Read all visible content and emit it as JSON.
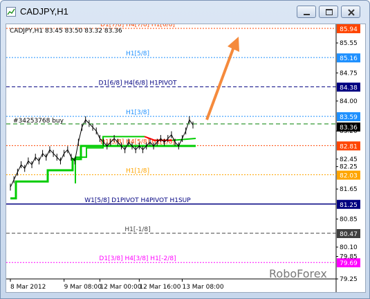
{
  "window": {
    "title": "CADJPY,H1",
    "buttons": [
      "minimize",
      "maximize",
      "close"
    ]
  },
  "chart_info": {
    "ohlc_line": "CADJPY,H1  83.45 83.50 83.32 83.36",
    "order_label": "#34253768 buy",
    "watermark": "RoboForex"
  },
  "colors": {
    "green": "#00cc00",
    "red": "#ff0000",
    "orange_arrow": "#f58a3c",
    "navy": "#000080"
  },
  "chart_data": {
    "type": "line",
    "symbol": "CADJPY",
    "timeframe": "H1",
    "ylim": [
      79.25,
      86.05
    ],
    "y_ticks": [
      "85.55",
      "84.75",
      "84.00",
      "83.20",
      "82.45",
      "82.25",
      "81.65",
      "80.85",
      "80.10",
      "79.85",
      "79.25"
    ],
    "x_ticks": [
      "8 Mar 2012",
      "9 Mar 08:00",
      "12 Mar 00:00",
      "12 Mar 16:00",
      "13 Mar 08:00"
    ],
    "current_price": "83.36",
    "levels": [
      {
        "label": "D1[7/8] H4[7/8] H1[6/8]",
        "value": 85.94,
        "price": "85.94",
        "color": "#ff4500",
        "style": "dot"
      },
      {
        "label": "H1[5/8]",
        "value": 85.16,
        "price": "85.16",
        "color": "#1e90ff",
        "style": "dot"
      },
      {
        "label": "D1[6/8] H4[6/8] H1PIVOT",
        "value": 84.38,
        "price": "84.38",
        "color": "#000080",
        "style": "dash"
      },
      {
        "label": "H1[3/8]",
        "value": 83.59,
        "price": "83.59",
        "color": "#1e90ff",
        "style": "dot"
      },
      {
        "label": "D1[5/8] H4[5/8] H1[2/8]",
        "value": 82.81,
        "price": "82.81",
        "color": "#ff4500",
        "style": "dot"
      },
      {
        "label": "H1[1/8]",
        "value": 82.03,
        "price": "82.03",
        "color": "#ffa500",
        "style": "dot"
      },
      {
        "label": "W1[5/8] D1PIVOT H4PIVOT H1SUP",
        "value": 81.25,
        "price": "81.25",
        "color": "#000080",
        "style": "solid"
      },
      {
        "label": "H1[-1/8]",
        "value": 80.47,
        "price": "80.47",
        "color": "#404040",
        "style": "dash"
      },
      {
        "label": "D1[3/8] H4[3/8] H1[-2/8]",
        "value": 79.69,
        "price": "79.69",
        "color": "#ff00ff",
        "style": "dot"
      }
    ],
    "series": [
      {
        "values": [
          81.7,
          81.9,
          82.1,
          82.3,
          82.2,
          82.4,
          82.3,
          82.5,
          82.4,
          82.6,
          82.5,
          82.7,
          82.6,
          82.5,
          82.4,
          82.6,
          82.7,
          82.5,
          82.4,
          82.9,
          83.3,
          83.5,
          83.4,
          83.3,
          83.2,
          83.0,
          82.9,
          82.8,
          82.9,
          83.0,
          82.9,
          82.8,
          82.7,
          82.9,
          82.8,
          82.7,
          82.8,
          82.7,
          82.8,
          82.9,
          82.8,
          82.9,
          83.0,
          82.9,
          83.0,
          83.1,
          82.9,
          82.8,
          83.0,
          83.2,
          83.5,
          83.36
        ]
      }
    ]
  }
}
